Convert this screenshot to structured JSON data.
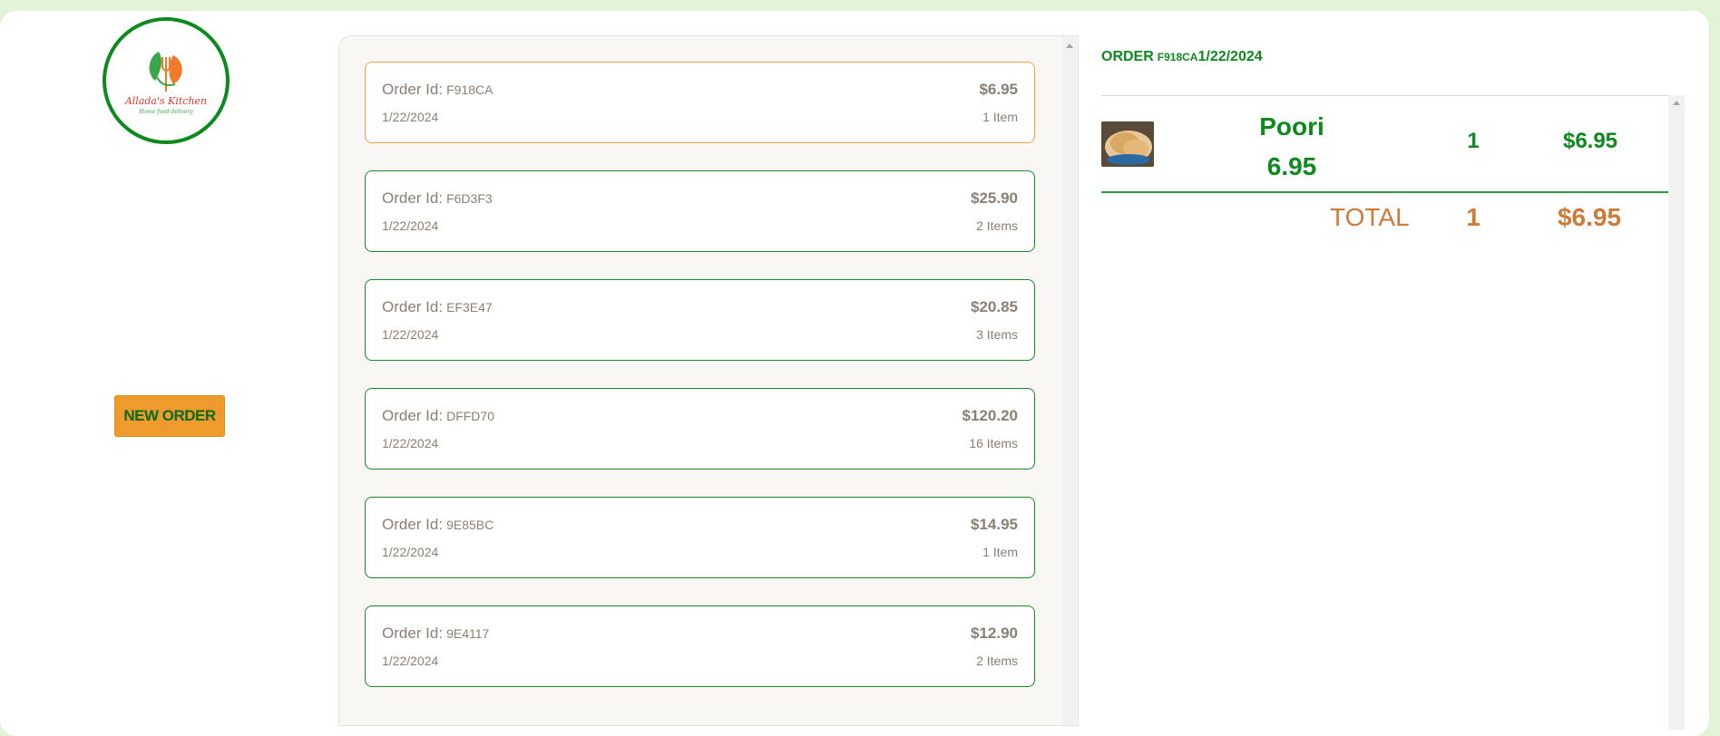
{
  "logo": {
    "name": "Allada's Kitchen",
    "tagline": "Home food delivery"
  },
  "new_order_label": "NEW ORDER",
  "orders": [
    {
      "id_label": "Order Id:",
      "id": "F918CA",
      "date": "1/22/2024",
      "total": "$6.95",
      "items": "1 Item",
      "selected": true
    },
    {
      "id_label": "Order Id:",
      "id": "F6D3F3",
      "date": "1/22/2024",
      "total": "$25.90",
      "items": "2 Items",
      "selected": false
    },
    {
      "id_label": "Order Id:",
      "id": "EF3E47",
      "date": "1/22/2024",
      "total": "$20.85",
      "items": "3 Items",
      "selected": false
    },
    {
      "id_label": "Order Id:",
      "id": "DFFD70",
      "date": "1/22/2024",
      "total": "$120.20",
      "items": "16 Items",
      "selected": false
    },
    {
      "id_label": "Order Id:",
      "id": "9E85BC",
      "date": "1/22/2024",
      "total": "$14.95",
      "items": "1 Item",
      "selected": false
    },
    {
      "id_label": "Order Id:",
      "id": "9E4117",
      "date": "1/22/2024",
      "total": "$12.90",
      "items": "2 Items",
      "selected": false
    }
  ],
  "detail": {
    "heading_label": "ORDER",
    "heading_id": "F918CA",
    "heading_date": "1/22/2024",
    "item": {
      "name": "Poori",
      "unit_price": "6.95",
      "qty": "1",
      "price": "$6.95"
    },
    "total_label": "TOTAL",
    "total_qty": "1",
    "total_price": "$6.95"
  },
  "colors": {
    "green": "#0c8a1e",
    "orange": "#ef9a2c",
    "total": "#d07a38",
    "selected_border": "#f0a04b"
  },
  "icons": {
    "logo": "fork-leaf-logo-icon",
    "item": "poori-food-photo"
  }
}
